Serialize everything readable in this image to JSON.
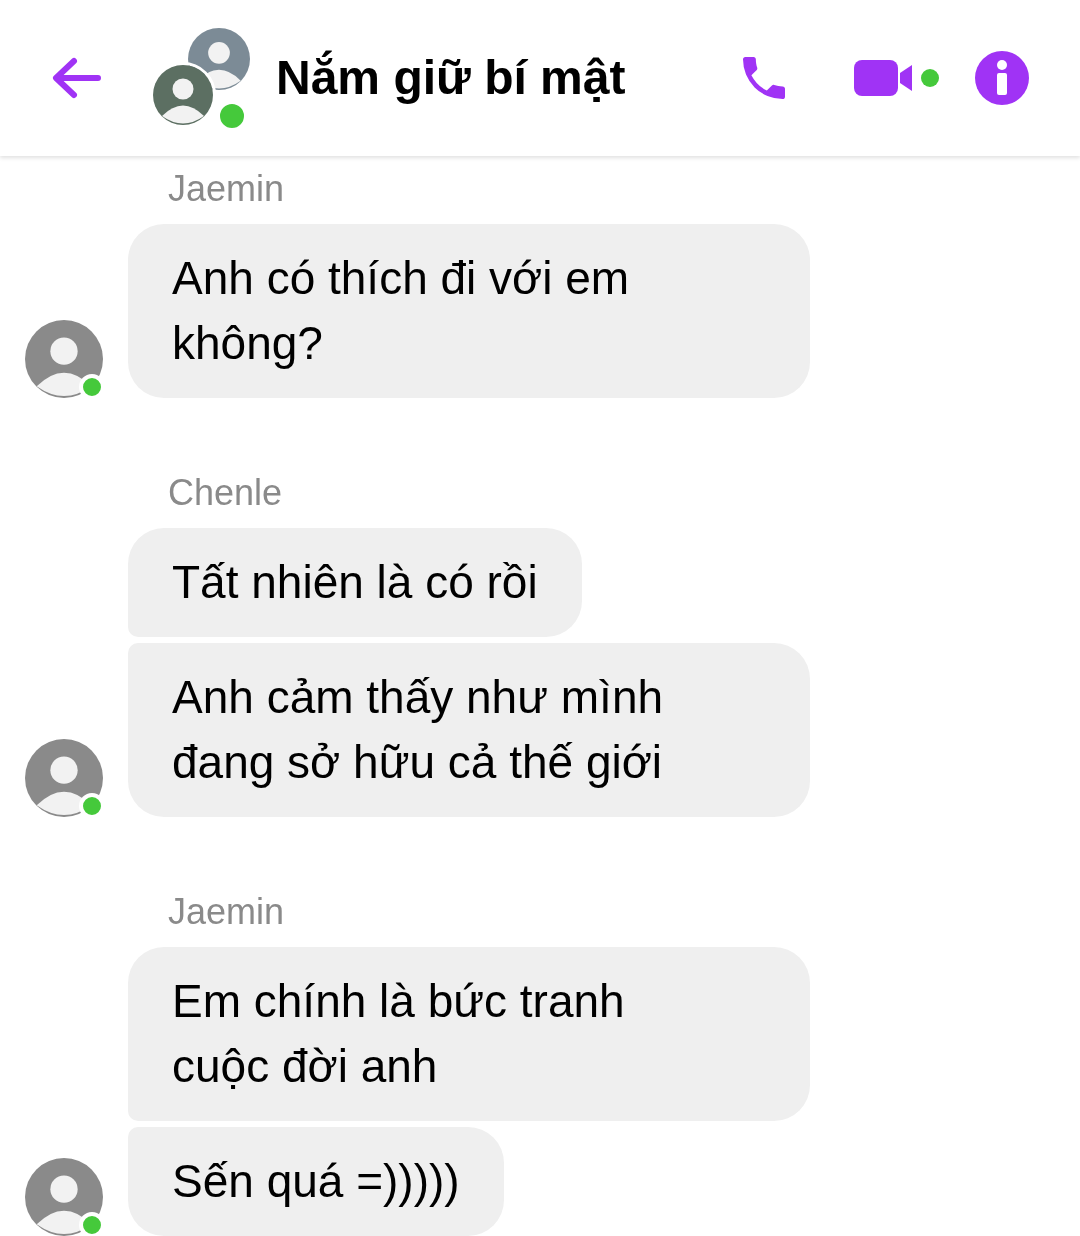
{
  "header": {
    "title": "Nắm giữ bí mật",
    "online": true
  },
  "groups": [
    {
      "sender": "Jaemin",
      "online": true,
      "messages": [
        {
          "lines": [
            "Anh có thích đi với em",
            "không?"
          ]
        }
      ]
    },
    {
      "sender": "Chenle",
      "online": true,
      "messages": [
        {
          "lines": [
            "Tất nhiên là có rồi"
          ]
        },
        {
          "lines": [
            "Anh cảm thấy như mình",
            "đang sở hữu cả thế giới"
          ]
        }
      ]
    },
    {
      "sender": "Jaemin",
      "online": true,
      "messages": [
        {
          "lines": [
            "Em chính là bức tranh",
            "cuộc đời anh"
          ]
        },
        {
          "lines": [
            "Sến quá =)))))"
          ]
        }
      ]
    }
  ]
}
